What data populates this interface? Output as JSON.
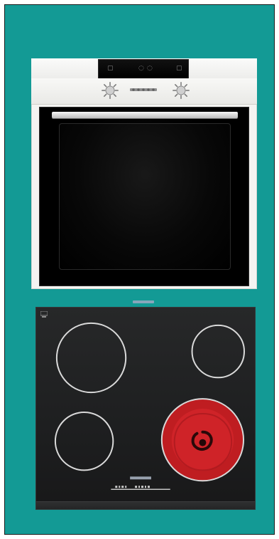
{
  "image": {
    "background": "#139a95",
    "frame_border": "#1b1b1b",
    "oven": {
      "body_color": "#f4f4f2",
      "door_color": "#000000",
      "handle_color": "#d8d8d8",
      "display_icons": [
        "clock-icon",
        "temperature-icon",
        "timer-icon"
      ]
    },
    "hob": {
      "surface_color": "#1f2021",
      "zone_outline_color": "#d7d7d7",
      "active_zone_color": "#c91f24",
      "zones": [
        "top-left",
        "top-right",
        "bottom-left",
        "bottom-right-active"
      ]
    }
  }
}
